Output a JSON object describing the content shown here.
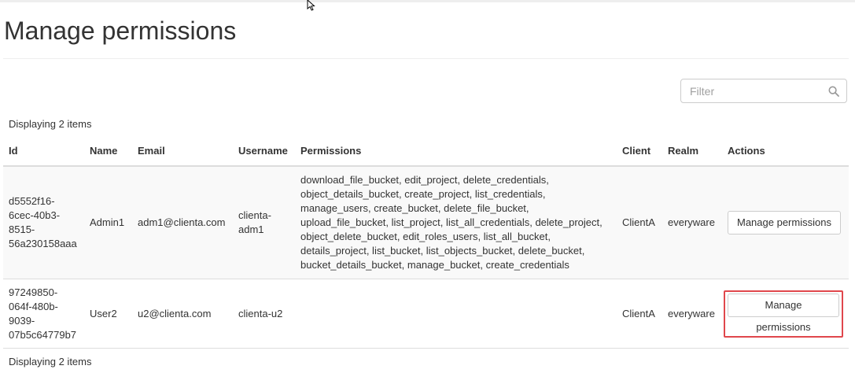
{
  "page": {
    "title": "Manage permissions"
  },
  "filter": {
    "placeholder": "Filter"
  },
  "summary": {
    "top": "Displaying 2 items",
    "bottom": "Displaying 2 items"
  },
  "table": {
    "headers": {
      "id": "Id",
      "name": "Name",
      "email": "Email",
      "username": "Username",
      "permissions": "Permissions",
      "client": "Client",
      "realm": "Realm",
      "actions": "Actions"
    },
    "rows": [
      {
        "id_lines": [
          "d5552f16-",
          "6cec-40b3-",
          "8515-",
          "56a230158aaa"
        ],
        "name": "Admin1",
        "email": "adm1@clienta.com",
        "username_lines": [
          "clienta-",
          "adm1"
        ],
        "permission_lines": [
          "download_file_bucket, edit_project, delete_credentials,",
          "object_details_bucket, create_project, list_credentials,",
          "manage_users, create_bucket, delete_file_bucket,",
          "upload_file_bucket, list_project, list_all_credentials, delete_project,",
          "object_delete_bucket, edit_roles_users, list_all_bucket,",
          "details_project, list_bucket, list_objects_bucket, delete_bucket,",
          "bucket_details_bucket, manage_bucket, create_credentials"
        ],
        "client": "ClientA",
        "realm": "everyware",
        "action_label": "Manage permissions"
      },
      {
        "id_lines": [
          "97249850-",
          "064f-480b-",
          "9039-",
          "07b5c64779b7"
        ],
        "name": "User2",
        "email": "u2@clienta.com",
        "username": "clienta-u2",
        "client": "ClientA",
        "realm": "everyware",
        "action_label": "Manage permissions"
      }
    ]
  },
  "icons": {
    "filter_icon": "search-icon",
    "pointer": "mouse-cursor-icon"
  },
  "colors": {
    "highlight": "#e0474c",
    "border": "#dddddd",
    "stripe": "#f9f9f9"
  }
}
